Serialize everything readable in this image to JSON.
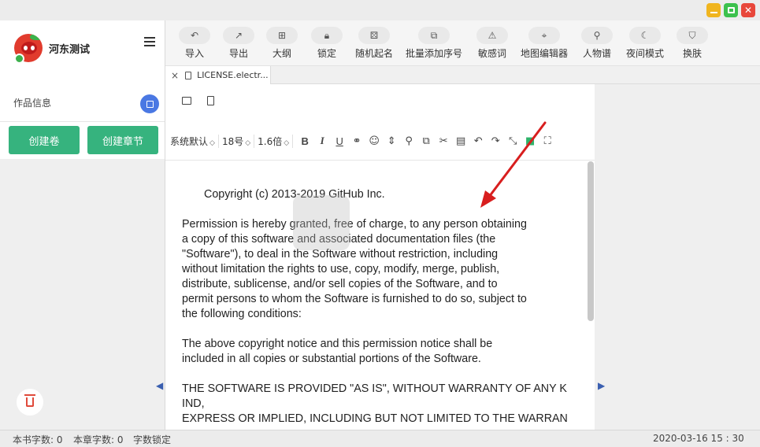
{
  "window": {
    "buttons": [
      "minimize",
      "maximize",
      "close"
    ]
  },
  "sidebar": {
    "app_name": "河东测试",
    "work_info_label": "作品信息",
    "create_volume_label": "创建卷",
    "create_chapter_label": "创建章节"
  },
  "toolbar": {
    "items": [
      {
        "label": "导入",
        "icon": "import-icon"
      },
      {
        "label": "导出",
        "icon": "export-icon"
      },
      {
        "label": "大纲",
        "icon": "outline-icon"
      },
      {
        "label": "锁定",
        "icon": "lock-icon"
      },
      {
        "label": "随机起名",
        "icon": "dice-icon"
      },
      {
        "label": "批量添加序号",
        "icon": "copy-icon"
      },
      {
        "label": "敏感词",
        "icon": "warning-icon"
      },
      {
        "label": "地图编辑器",
        "icon": "map-icon"
      },
      {
        "label": "人物谱",
        "icon": "add-person-icon"
      },
      {
        "label": "夜间模式",
        "icon": "moon-icon"
      },
      {
        "label": "换肤",
        "icon": "shirt-icon"
      }
    ]
  },
  "tab": {
    "close_glyph": "×",
    "name": "LICENSE.electr..."
  },
  "format": {
    "font": "系统默认",
    "size": "18号",
    "line_height": "1.6倍",
    "bold": "B",
    "italic": "I",
    "underline": "U"
  },
  "content": {
    "paragraphs": [
      "Copyright (c) 2013-2019 GitHub Inc.",
      "Permission is hereby granted, free of charge, to any person obtaining\na copy of this software and associated documentation files (the\n\"Software\"), to deal in the Software without restriction, including\nwithout limitation the rights to use, copy, modify, merge, publish,\ndistribute, sublicense, and/or sell copies of the Software, and to\npermit persons to whom the Software is furnished to do so, subject to\nthe following conditions:",
      "The above copyright notice and this permission notice shall be\nincluded in all copies or substantial portions of the Software.",
      "THE SOFTWARE IS PROVIDED \"AS IS\", WITHOUT WARRANTY OF ANY K\nIND,\nEXPRESS OR IMPLIED, INCLUDING BUT NOT LIMITED TO THE WARRAN"
    ]
  },
  "status": {
    "book_words": "本书字数: 0",
    "chapter_words": "本章字数: 0",
    "word_lock": "字数锁定",
    "datetime": "2020-03-16 15 : 30"
  },
  "colors": {
    "accent_green": "#36b37e",
    "edit_blue": "#4a78e3",
    "annotation_arrow": "#d81e1e"
  }
}
